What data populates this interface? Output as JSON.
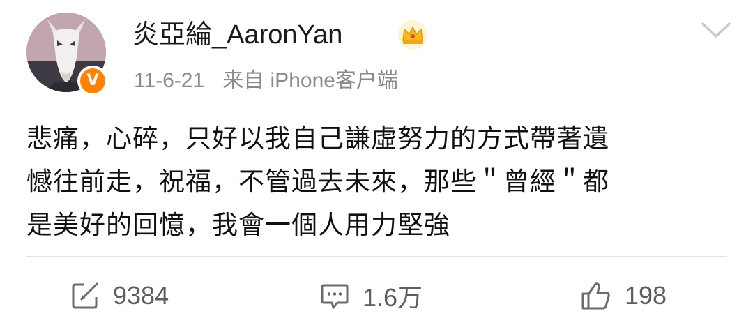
{
  "post": {
    "username": "炎亞綸_AaronYan",
    "date": "11-6-21",
    "source": "来自 iPhone客户端",
    "verified_badge": "V",
    "content_lines": [
      "悲痛，心碎，只好以我自己謙虛努力的方式帶著遺",
      "憾往前走，祝福，不管過去未來，那些＂曾經＂都",
      "是美好的回憶，我會一個人用力堅強"
    ]
  },
  "actions": {
    "repost_count": "9384",
    "comment_count": "1.6万",
    "like_count": "198"
  },
  "colors": {
    "badge": "#ff8200",
    "crown": "#f5b81e",
    "meta_text": "#8a8a8a",
    "action_text": "#5d5d5d"
  },
  "icons": [
    "crown-icon",
    "chevron-down-icon",
    "verified-v-icon",
    "repost-icon",
    "comment-icon",
    "like-icon"
  ]
}
